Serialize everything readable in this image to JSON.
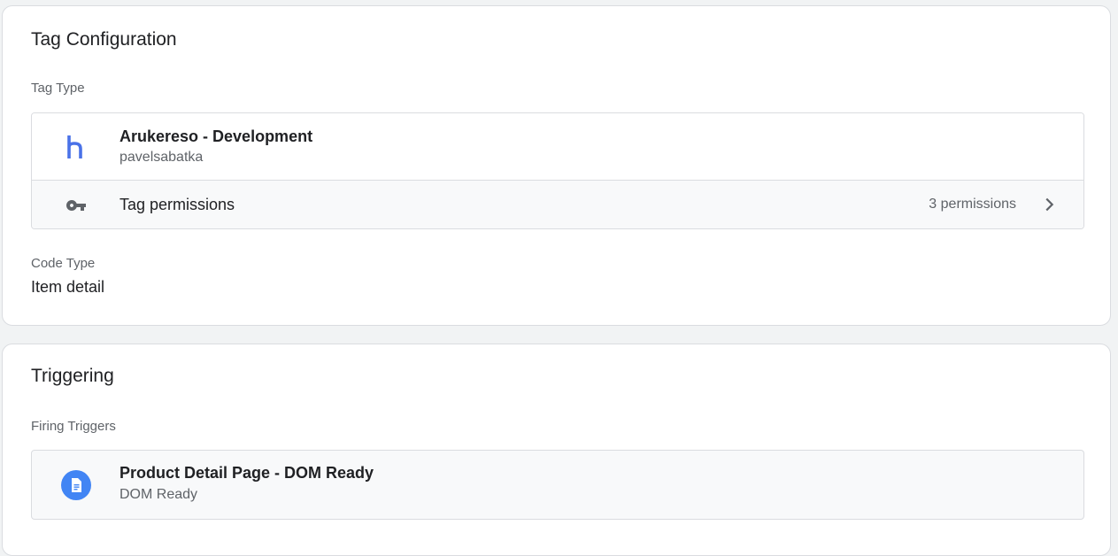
{
  "tag_configuration": {
    "title": "Tag Configuration",
    "tag_type_label": "Tag Type",
    "tag_type": {
      "icon": "h-letter-icon",
      "name": "Arukereso - Development",
      "author": "pavelsabatka"
    },
    "permissions": {
      "icon": "key-icon",
      "label": "Tag permissions",
      "count": "3 permissions"
    },
    "code_type_label": "Code Type",
    "code_type_value": "Item detail"
  },
  "triggering": {
    "title": "Triggering",
    "firing_label": "Firing Triggers",
    "trigger": {
      "icon": "page-document-icon",
      "name": "Product Detail Page - DOM Ready",
      "type": "DOM Ready"
    }
  },
  "colors": {
    "accent_blue": "#4285f4",
    "h_icon": "#4a72e8",
    "icon_gray": "#5f6368"
  }
}
